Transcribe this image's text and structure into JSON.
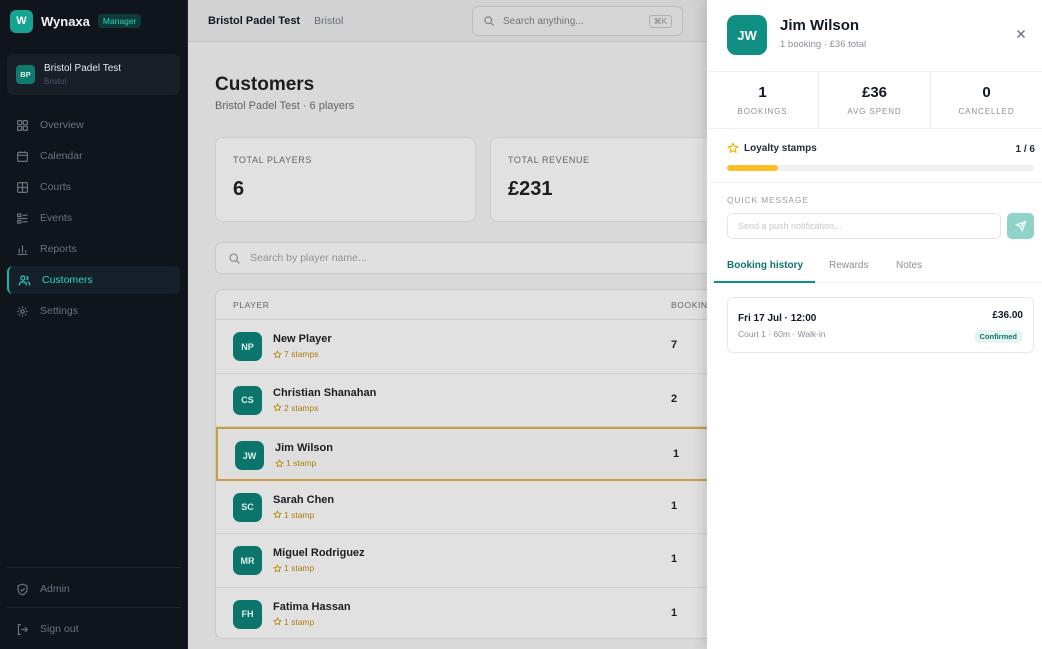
{
  "brand": {
    "logo_letter": "W",
    "name": "Wynaxa",
    "badge": "Manager"
  },
  "venue": {
    "initials": "BP",
    "name": "Bristol Padel Test",
    "city": "Bristol"
  },
  "nav": {
    "items": [
      {
        "label": "Overview",
        "icon": "grid-icon"
      },
      {
        "label": "Calendar",
        "icon": "calendar-icon"
      },
      {
        "label": "Courts",
        "icon": "courts-icon"
      },
      {
        "label": "Events",
        "icon": "events-icon"
      },
      {
        "label": "Reports",
        "icon": "chart-icon"
      },
      {
        "label": "Customers",
        "icon": "users-icon",
        "active": true
      },
      {
        "label": "Settings",
        "icon": "gear-icon"
      }
    ],
    "admin_label": "Admin",
    "signout_label": "Sign out"
  },
  "topbar": {
    "title": "Bristol Padel Test",
    "subtitle": "Bristol",
    "search_placeholder": "Search anything...",
    "shortcut": "⌘K"
  },
  "page": {
    "title": "Customers",
    "subtitle": "Bristol Padel Test · 6 players"
  },
  "stats": [
    {
      "label": "TOTAL PLAYERS",
      "value": "6"
    },
    {
      "label": "TOTAL REVENUE",
      "value": "£231"
    }
  ],
  "player_search": {
    "placeholder": "Search by player name..."
  },
  "table": {
    "headers": {
      "player": "PLAYER",
      "bookings": "BOOKINGS"
    },
    "rows": [
      {
        "initials": "NP",
        "name": "New Player",
        "stamps": "7 stamps",
        "bookings": "7"
      },
      {
        "initials": "CS",
        "name": "Christian Shanahan",
        "stamps": "2 stamps",
        "bookings": "2"
      },
      {
        "initials": "JW",
        "name": "Jim Wilson",
        "stamps": "1 stamp",
        "bookings": "1",
        "selected": true
      },
      {
        "initials": "SC",
        "name": "Sarah Chen",
        "stamps": "1 stamp",
        "bookings": "1"
      },
      {
        "initials": "MR",
        "name": "Miguel Rodriguez",
        "stamps": "1 stamp",
        "bookings": "1"
      },
      {
        "initials": "FH",
        "name": "Fatima Hassan",
        "stamps": "1 stamp",
        "bookings": "1"
      }
    ]
  },
  "drawer": {
    "initials": "JW",
    "name": "Jim Wilson",
    "meta": "1 booking · £36 total",
    "stats": [
      {
        "value": "1",
        "label": "BOOKINGS"
      },
      {
        "value": "£36",
        "label": "AVG SPEND"
      },
      {
        "value": "0",
        "label": "CANCELLED"
      }
    ],
    "loyalty": {
      "title": "Loyalty stamps",
      "count": "1 / 6",
      "progress": 0.1667
    },
    "quick_message": {
      "label": "QUICK MESSAGE",
      "placeholder": "Send a push notification..."
    },
    "tabs": [
      {
        "label": "Booking history",
        "active": true
      },
      {
        "label": "Rewards"
      },
      {
        "label": "Notes"
      }
    ],
    "bookings": [
      {
        "date": "Fri 17 Jul · 12:00",
        "detail": "Court 1 · 60m · Walk-in",
        "price": "£36.00",
        "status": "Confirmed"
      }
    ]
  },
  "colors": {
    "accent": "#0f8f82",
    "highlight": "#d7a64a",
    "stamp": "#fbbf24"
  }
}
